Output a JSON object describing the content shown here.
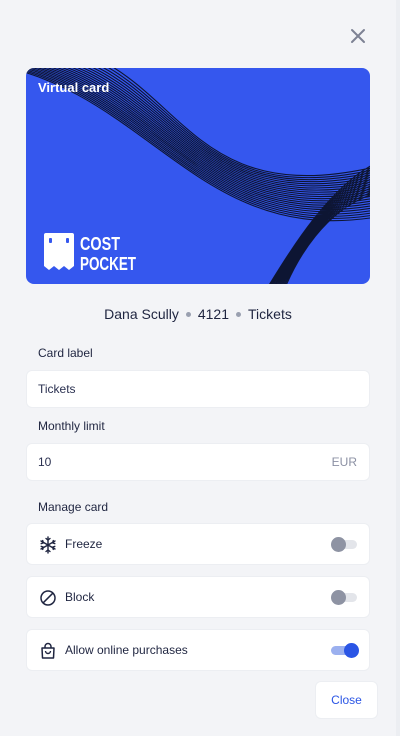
{
  "header": {
    "close_icon": "close-icon"
  },
  "card": {
    "title": "Virtual card",
    "background_color": "#3557ee",
    "logo": {
      "line1": "COST",
      "line2": "POCKET"
    }
  },
  "owner": {
    "name": "Dana Scully",
    "last_digits": "4121",
    "label": "Tickets"
  },
  "form": {
    "card_label": {
      "label": "Card label",
      "value": "Tickets"
    },
    "monthly_limit": {
      "label": "Monthly limit",
      "value": "10",
      "currency": "EUR"
    }
  },
  "manage": {
    "heading": "Manage card",
    "items": [
      {
        "label": "Freeze",
        "icon": "snowflake-icon",
        "enabled": false
      },
      {
        "label": "Block",
        "icon": "block-icon",
        "enabled": false
      },
      {
        "label": "Allow online purchases",
        "icon": "shopping-bag-icon",
        "enabled": true
      }
    ]
  },
  "footer": {
    "close_label": "Close"
  },
  "colors": {
    "accent": "#2a55e5",
    "background": "#f3f4f7"
  }
}
